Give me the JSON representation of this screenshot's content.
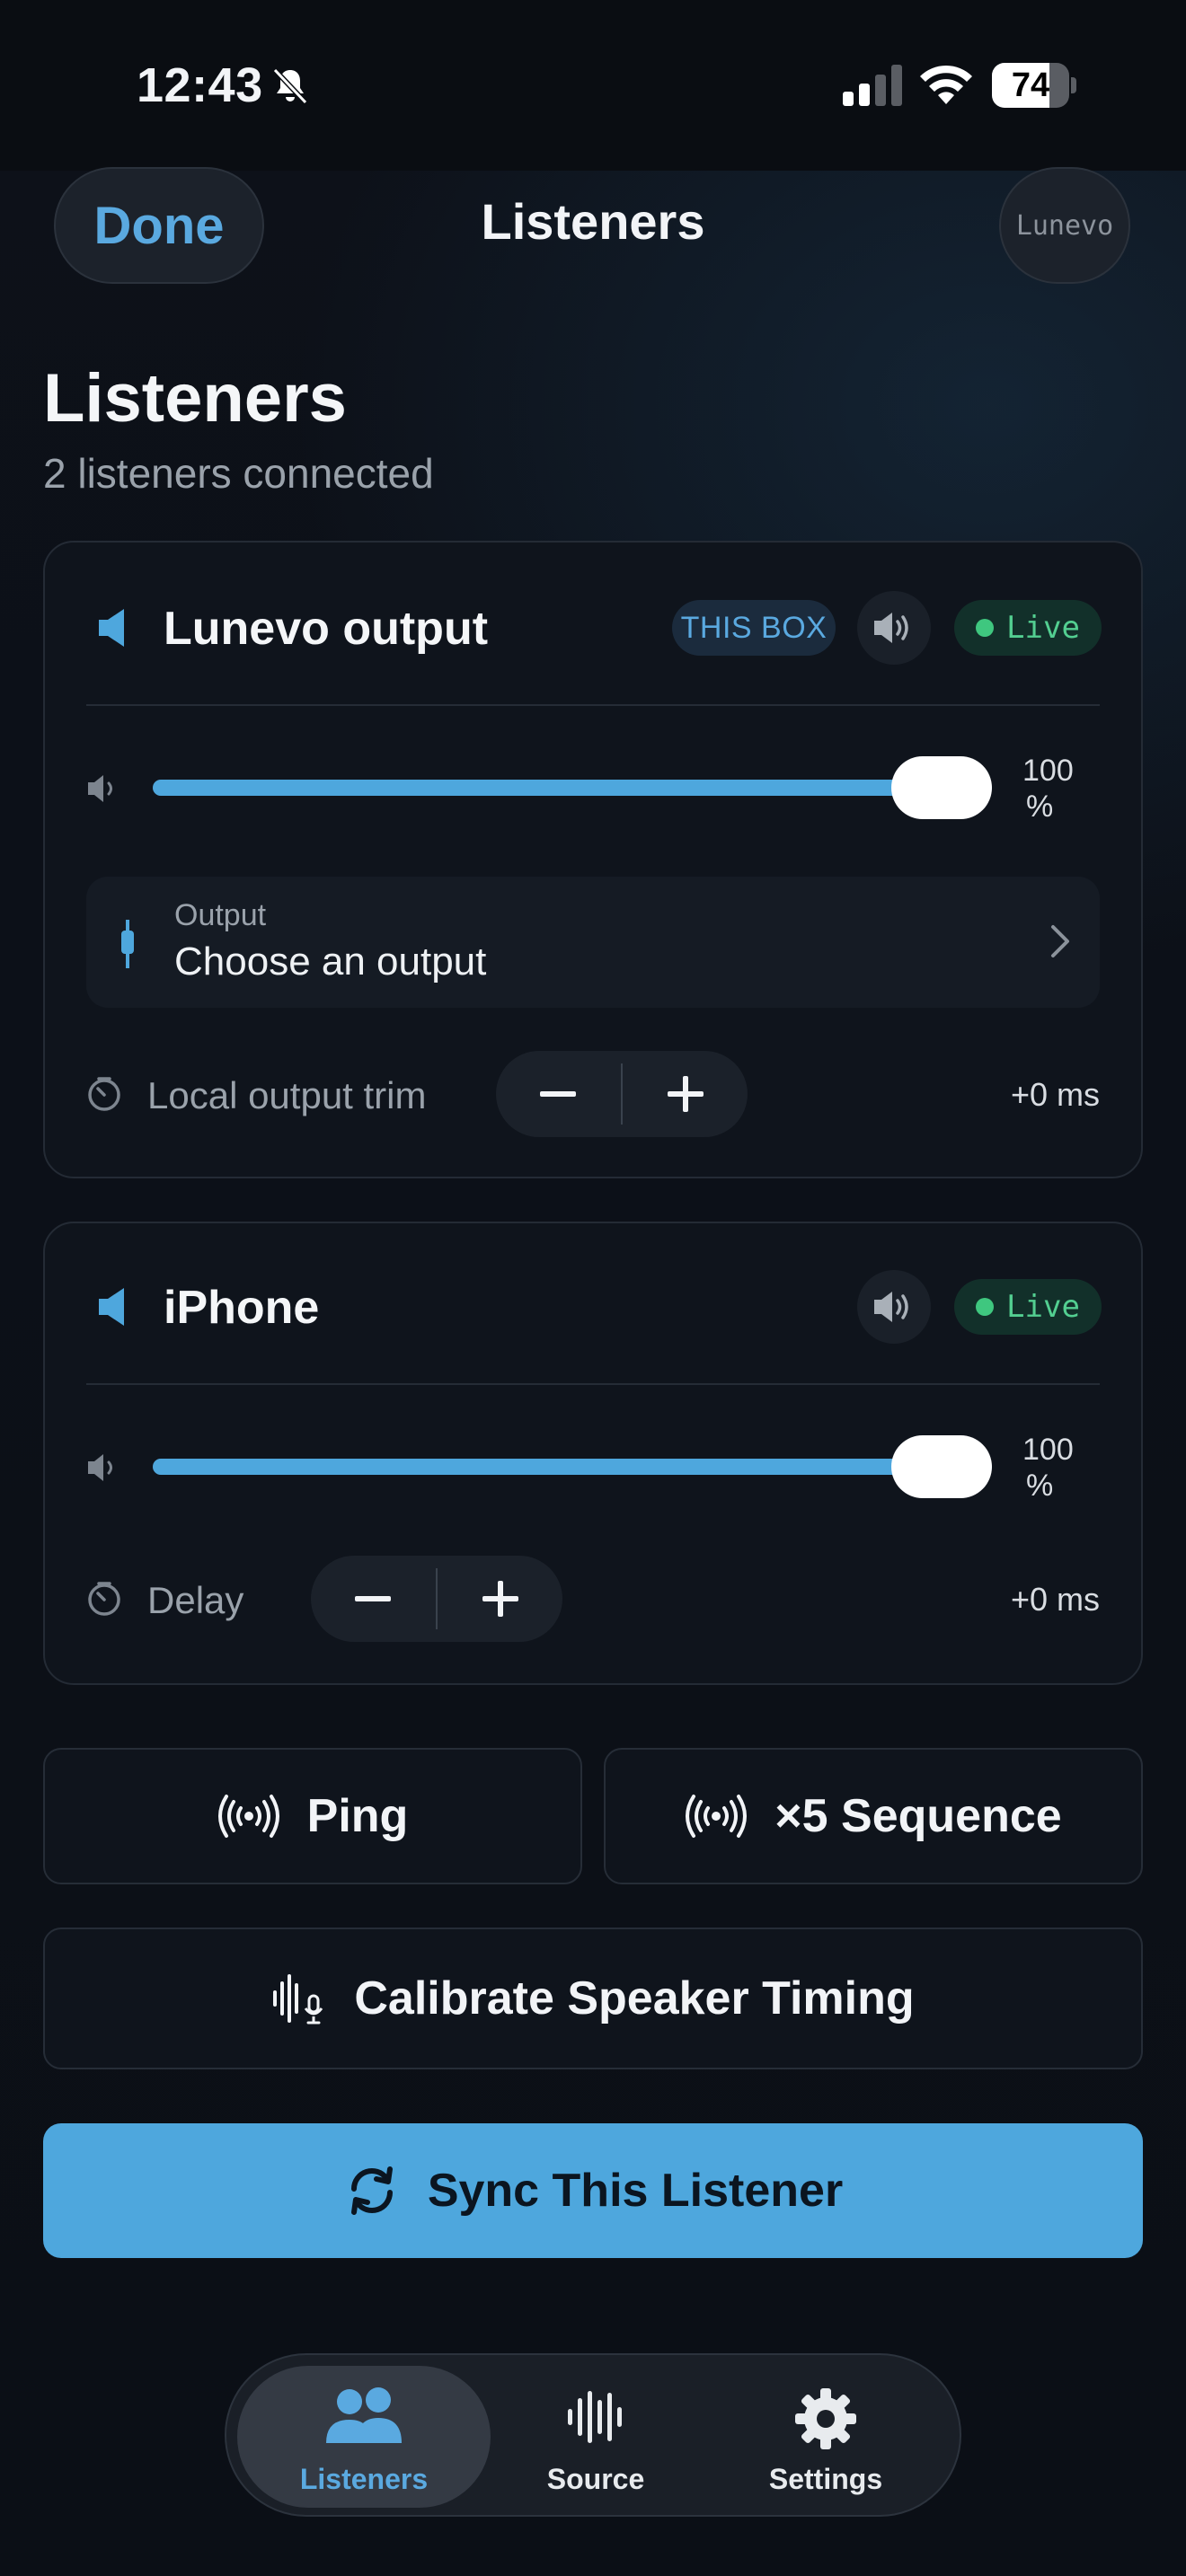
{
  "status_bar": {
    "time": "12:43",
    "battery_percent": "74",
    "battery_level": 0.74
  },
  "nav": {
    "done_label": "Done",
    "title": "Listeners",
    "brand": "Lunevo"
  },
  "page": {
    "title": "Listeners",
    "subtitle": "2 listeners connected"
  },
  "listeners": [
    {
      "name": "Lunevo output",
      "badge": "THIS BOX",
      "status": "Live",
      "volume": 1.0,
      "volume_label": "100",
      "volume_unit": "%",
      "output_label": "Output",
      "output_value": "Choose an output",
      "trim_label": "Local output trim",
      "trim_value": "+0 ms"
    },
    {
      "name": "iPhone",
      "status": "Live",
      "volume": 1.0,
      "volume_label": "100",
      "volume_unit": "%",
      "trim_label": "Delay",
      "trim_value": "+0 ms"
    }
  ],
  "actions": {
    "ping": "Ping",
    "sequence": "×5 Sequence",
    "calibrate": "Calibrate Speaker Timing",
    "sync": "Sync This Listener"
  },
  "tabs": [
    {
      "label": "Listeners",
      "icon": "people-icon",
      "active": true
    },
    {
      "label": "Source",
      "icon": "waveform-icon",
      "active": false
    },
    {
      "label": "Settings",
      "icon": "gear-icon",
      "active": false
    }
  ],
  "colors": {
    "accent": "#4ea7dd",
    "live": "#3fc77f",
    "background": "#0b0f16"
  }
}
